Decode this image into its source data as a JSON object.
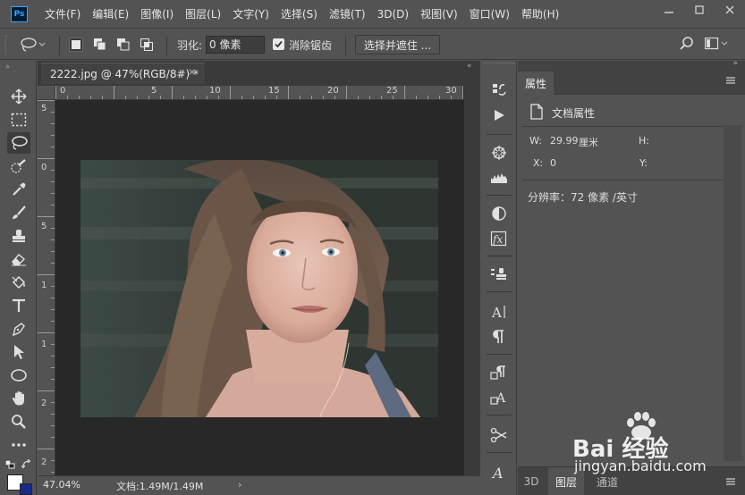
{
  "app": {
    "logo": "Ps",
    "menu": [
      "文件(F)",
      "编辑(E)",
      "图像(I)",
      "图层(L)",
      "文字(Y)",
      "选择(S)",
      "滤镜(T)",
      "3D(D)",
      "视图(V)",
      "窗口(W)",
      "帮助(H)"
    ],
    "window_controls": [
      "minimize-icon",
      "restore-icon",
      "close-icon"
    ]
  },
  "options_bar": {
    "tool_icon": "lasso-icon",
    "selection_modes": [
      "new-selection-icon",
      "add-selection-icon",
      "subtract-selection-icon",
      "intersect-selection-icon"
    ],
    "feather_label": "羽化:",
    "feather_value": "0 像素",
    "antialias_checked": true,
    "antialias_label": "消除锯齿",
    "select_mask_label": "选择并遮住 ..."
  },
  "document": {
    "tab_title": "2222.jpg @ 47%(RGB/8#) *",
    "tab_close": "×",
    "ruler_h_labels": [
      "5",
      "0",
      "5",
      "10",
      "15",
      "20",
      "25",
      "30"
    ],
    "ruler_v_labels": [
      "5",
      "0",
      "5",
      "1",
      "1",
      "2",
      "2"
    ]
  },
  "status_bar": {
    "zoom": "47.04%",
    "doc_size": "文档:1.49M/1.49M",
    "arrow": "›"
  },
  "tools": [
    "move-icon",
    "marquee-icon",
    "lasso-icon",
    "quick-selection-icon",
    "eyedropper-icon",
    "brush-icon",
    "clone-stamp-icon",
    "eraser-icon",
    "paint-bucket-icon",
    "type-icon",
    "pen-icon",
    "path-selection-icon",
    "ellipse-icon",
    "hand-icon",
    "zoom-icon",
    "more-tools-icon"
  ],
  "icon_strip": [
    "history-icon",
    "actions-icon",
    "navigator-icon",
    "histogram-icon",
    "adjustments-icon",
    "styles-icon",
    "clone-source-icon",
    "character-icon",
    "paragraph-icon",
    "paragraph-styles-icon",
    "character-styles-icon",
    "tools-presets-icon",
    "glyphs-icon"
  ],
  "properties": {
    "tab_label": "属性",
    "section_label": "文档属性",
    "w_label": "W:",
    "w_value": "29.99",
    "w_unit": "厘米",
    "h_label": "H:",
    "x_label": "X:",
    "x_value": "0",
    "y_label": "Y:",
    "resolution": "分辨率：72 像素 /英寸",
    "bottom_tabs": [
      "3D",
      "图层",
      "通道"
    ]
  },
  "watermark": {
    "text": "Bai 经验",
    "url": "jingyan.baidu.com"
  }
}
